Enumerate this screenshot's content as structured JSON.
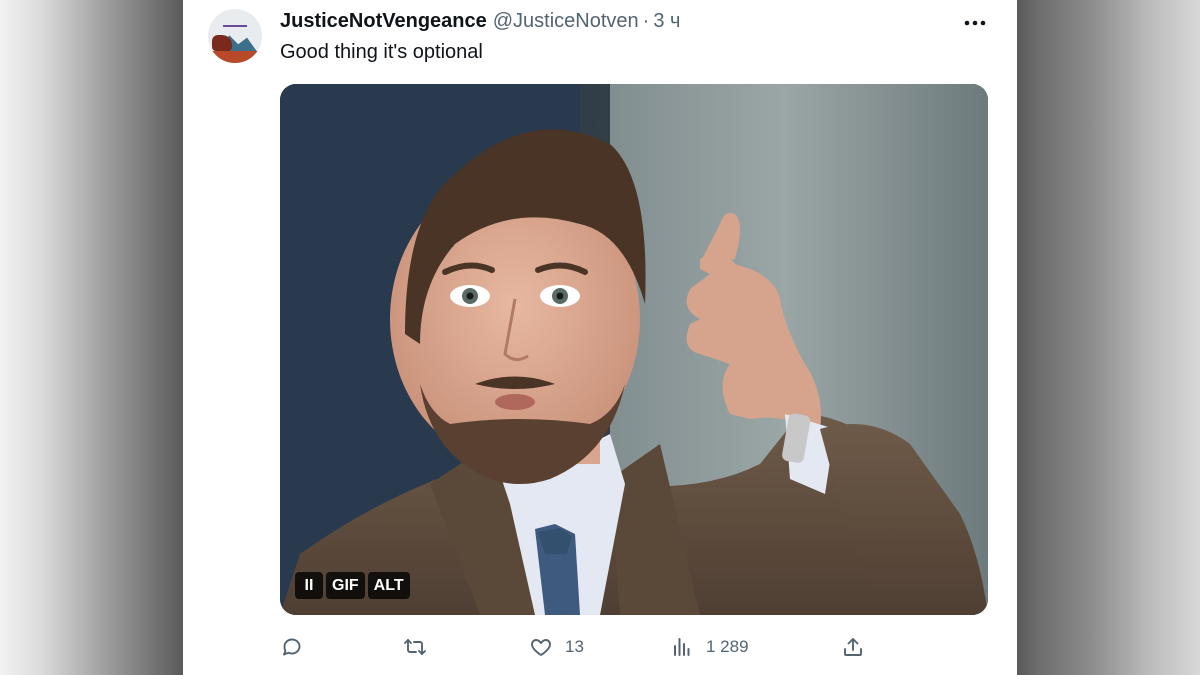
{
  "tweet": {
    "display_name": "JusticeNotVengeance",
    "handle": "@JusticeNotven",
    "separator": "·",
    "time": "3 ч",
    "text": "Good thing it's optional"
  },
  "media": {
    "type": "gif",
    "controls": {
      "pause_label": "II",
      "gif_label": "GIF",
      "alt_label": "ALT"
    }
  },
  "actions": {
    "reply": {
      "icon": "reply-icon",
      "count": ""
    },
    "retweet": {
      "icon": "retweet-icon",
      "count": ""
    },
    "like": {
      "icon": "heart-icon",
      "count": "13"
    },
    "views": {
      "icon": "bar-chart-icon",
      "count": "1 289"
    },
    "share": {
      "icon": "share-icon"
    }
  },
  "colors": {
    "text_primary": "#0f1419",
    "text_secondary": "#536471",
    "background": "#ffffff"
  }
}
